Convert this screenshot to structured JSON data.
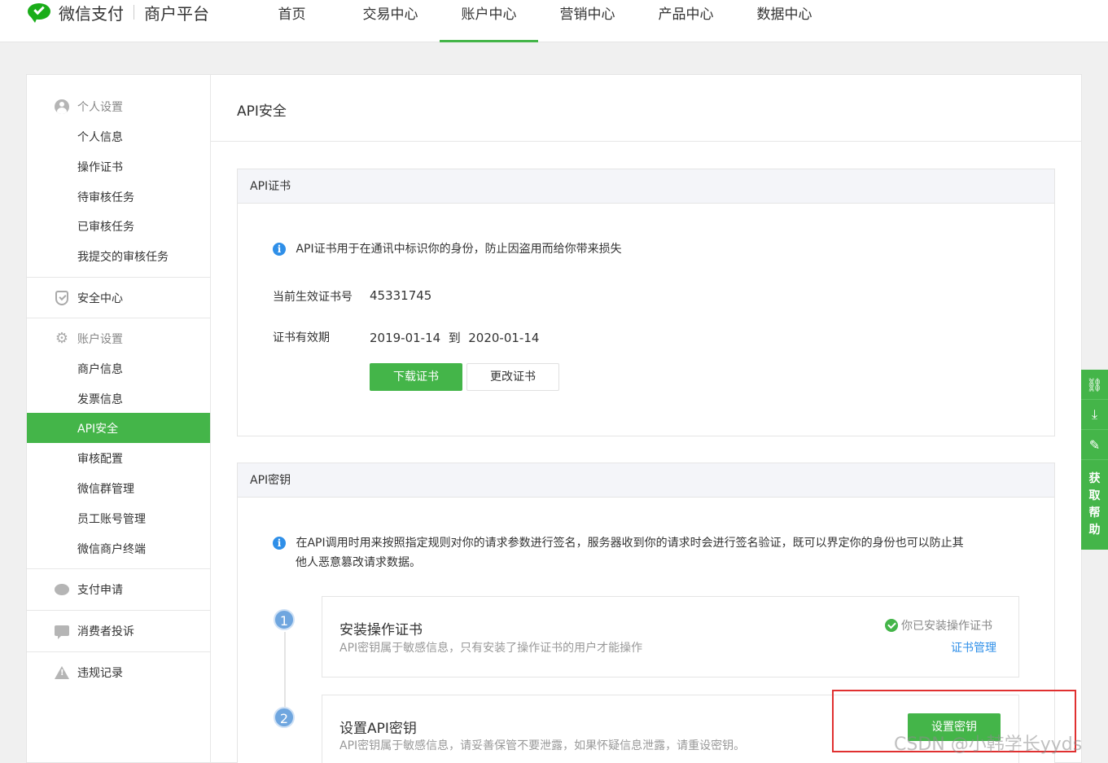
{
  "brand": {
    "name": "微信支付",
    "sub": "商户平台"
  },
  "nav": [
    {
      "label": "首页",
      "active": false
    },
    {
      "label": "交易中心",
      "active": false
    },
    {
      "label": "账户中心",
      "active": true
    },
    {
      "label": "营销中心",
      "active": false
    },
    {
      "label": "产品中心",
      "active": false
    },
    {
      "label": "数据中心",
      "active": false
    }
  ],
  "sidebar": {
    "personal": {
      "title": "个人设置",
      "items": [
        "个人信息",
        "操作证书",
        "待审核任务",
        "已审核任务",
        "我提交的审核任务"
      ]
    },
    "security": {
      "title": "安全中心"
    },
    "account": {
      "title": "账户设置",
      "items": [
        "商户信息",
        "发票信息",
        "API安全",
        "审核配置",
        "微信群管理",
        "员工账号管理",
        "微信商户终端"
      ],
      "active": "API安全"
    },
    "pay_apply": {
      "title": "支付申请"
    },
    "complaints": {
      "title": "消费者投诉"
    },
    "violations": {
      "title": "违规记录"
    }
  },
  "page_title": "API安全",
  "cert": {
    "header": "API证书",
    "info": "API证书用于在通讯中标识你的身份，防止因盗用而给你带来损失",
    "serial_label": "当前生效证书号",
    "serial_value": "45331745",
    "validity_label": "证书有效期",
    "validity_value": "2019-01-14  到  2020-01-14",
    "download_button": "下载证书",
    "change_button": "更改证书"
  },
  "key": {
    "header": "API密钥",
    "info_line1": "在API调用时用来按照指定规则对你的请求参数进行签名，服务器收到你的请求时会进行签名验证，既可以界定你的身份也可以防止其",
    "info_line2": "他人恶意篡改请求数据。",
    "steps": [
      {
        "num": "1",
        "title": "安装操作证书",
        "desc": "API密钥属于敏感信息，只有安装了操作证书的用户才能操作",
        "status": "你已安装操作证书",
        "link": "证书管理"
      },
      {
        "num": "2",
        "title": "设置API密钥",
        "desc": "API密钥属于敏感信息，请妥善保管不要泄露，如果怀疑信息泄露，请重设密钥。",
        "button": "设置密钥"
      }
    ]
  },
  "float_help": [
    "获",
    "取",
    "帮",
    "助"
  ],
  "watermark": "CSDN @小韩学长yyds",
  "colors": {
    "accent": "#44b549",
    "link": "#2f8fe8",
    "highlight": "#e03030"
  }
}
